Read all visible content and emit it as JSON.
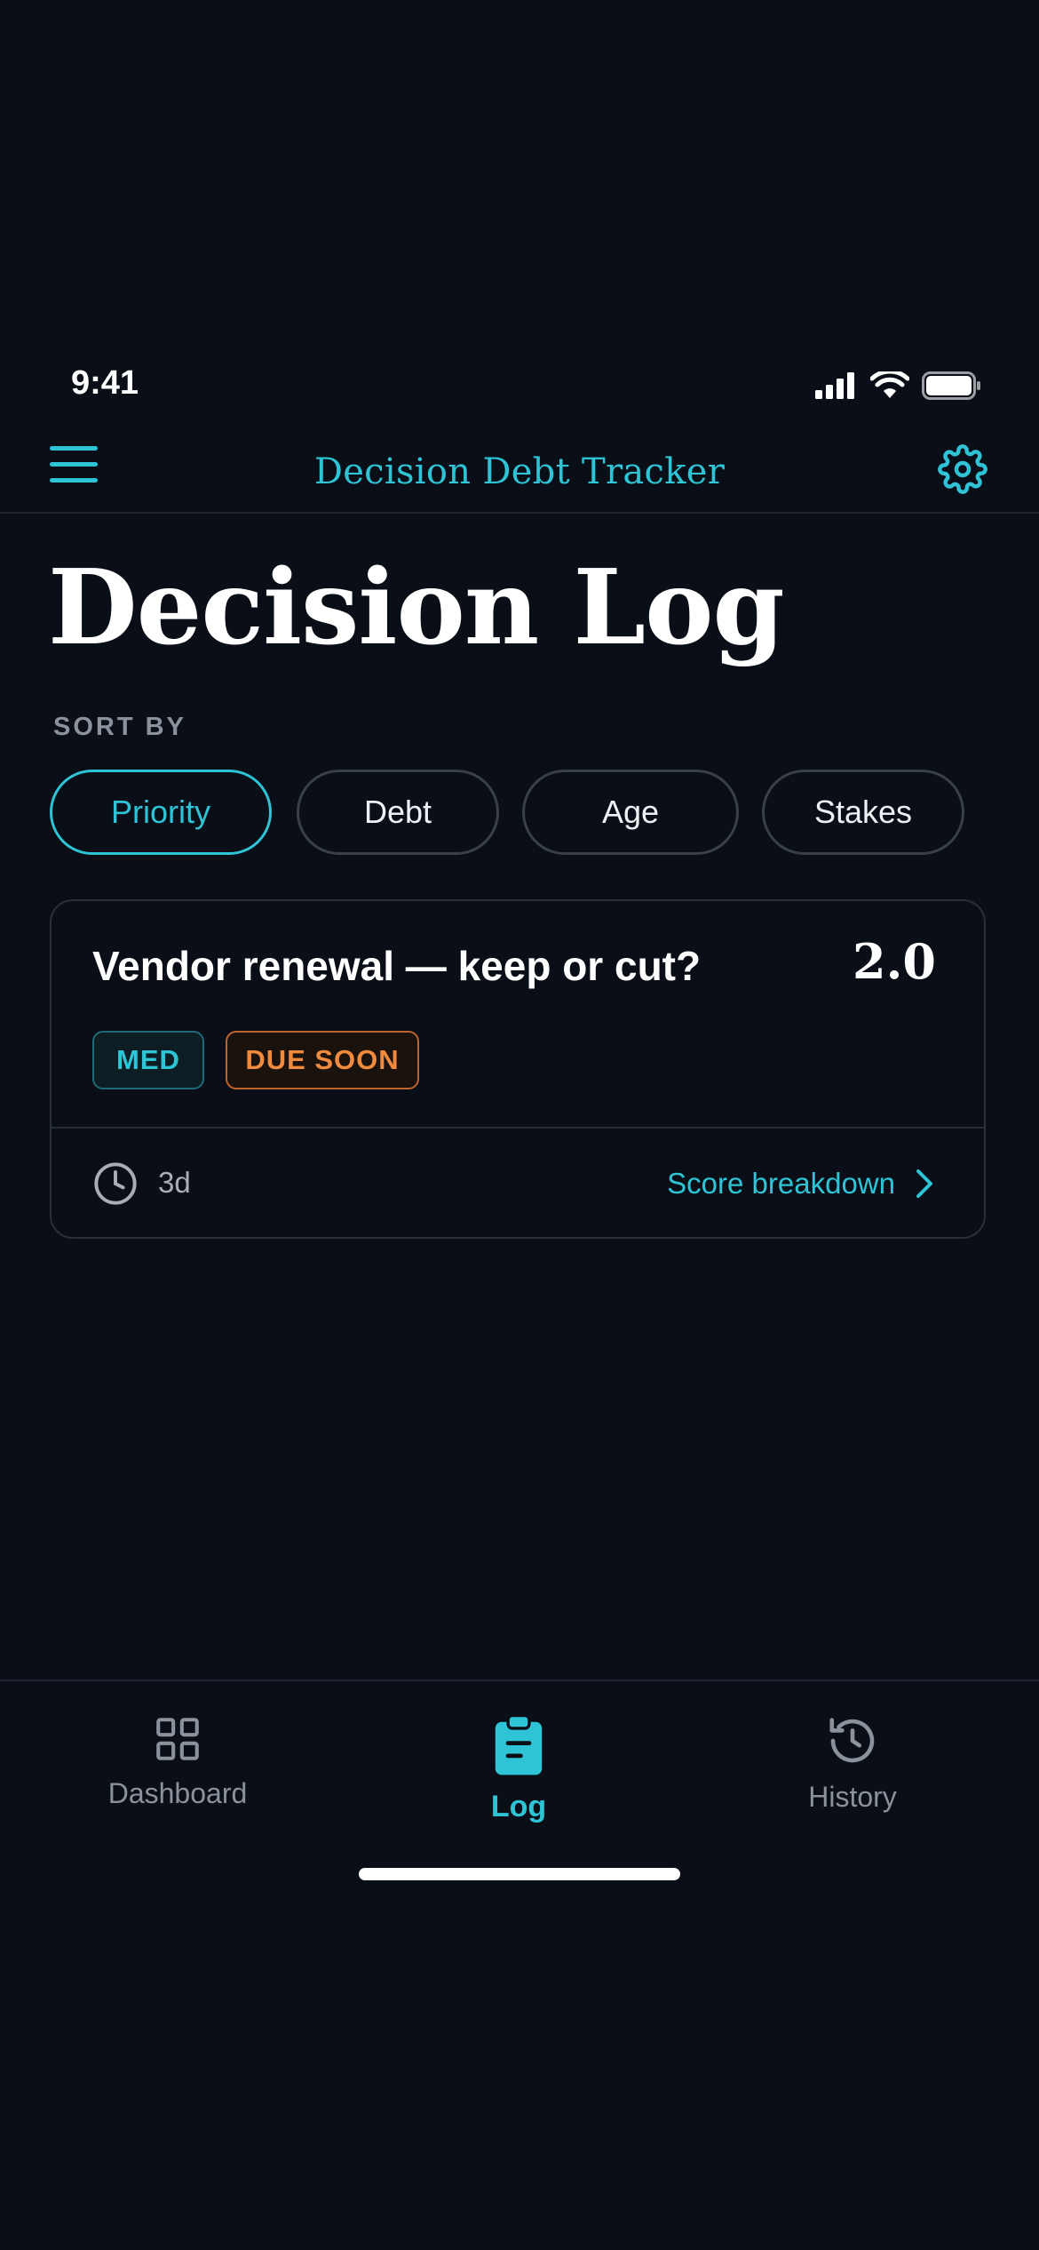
{
  "status_bar": {
    "time": "9:41",
    "icons": [
      "signal-icon",
      "wifi-icon",
      "battery-icon"
    ]
  },
  "nav": {
    "title": "Decision Debt Tracker",
    "menu_icon": "hamburger-menu-icon",
    "settings_icon": "gear-icon"
  },
  "page": {
    "title": "Decision Log",
    "sort_label": "SORT BY"
  },
  "sort_options": [
    {
      "label": "Priority",
      "selected": true
    },
    {
      "label": "Debt",
      "selected": false
    },
    {
      "label": "Age",
      "selected": false
    },
    {
      "label": "Stakes",
      "selected": false
    }
  ],
  "decisions": [
    {
      "title": "Vendor renewal — keep or cut?",
      "score": "2.0",
      "badges": [
        "MED",
        "DUE SOON"
      ],
      "age": "3d",
      "action_label": "Score breakdown"
    }
  ],
  "tabs": [
    {
      "label": "Dashboard",
      "icon": "grid-icon",
      "active": false
    },
    {
      "label": "Log",
      "icon": "clipboard-icon",
      "active": true
    },
    {
      "label": "History",
      "icon": "history-icon",
      "active": false
    }
  ],
  "colors": {
    "background": "#0a0e17",
    "accent": "#2ec4d6",
    "warning": "#f08a3c",
    "muted_text": "#8c929c"
  }
}
